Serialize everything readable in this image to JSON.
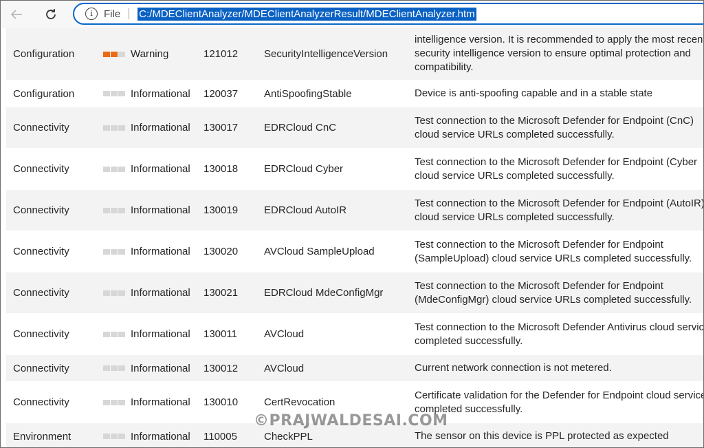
{
  "browser": {
    "scheme": "File",
    "url": "C:/MDEClientAnalyzer/MDEClientAnalyzerResult/MDEClientAnalyzer.htm"
  },
  "colors": {
    "warning": "#ea6a16",
    "info_bar": "#d7d7d7",
    "selection": "#0a61c4"
  },
  "rows": [
    {
      "category": "Configuration",
      "severity": "Warning",
      "id": "121012",
      "name": "SecurityIntelligenceVersion",
      "description": "intelligence version. It is recommended to apply the most recent security intelligence version to ensure optimal protection and compatibility."
    },
    {
      "category": "Configuration",
      "severity": "Informational",
      "id": "120037",
      "name": "AntiSpoofingStable",
      "description": "Device is anti-spoofing capable and in a stable state"
    },
    {
      "category": "Connectivity",
      "severity": "Informational",
      "id": "130017",
      "name": "EDRCloud CnC",
      "description": "Test connection to the Microsoft Defender for Endpoint (CnC) cloud service URLs completed successfully."
    },
    {
      "category": "Connectivity",
      "severity": "Informational",
      "id": "130018",
      "name": "EDRCloud Cyber",
      "description": "Test connection to the Microsoft Defender for Endpoint (Cyber cloud service URLs completed successfully."
    },
    {
      "category": "Connectivity",
      "severity": "Informational",
      "id": "130019",
      "name": "EDRCloud AutoIR",
      "description": "Test connection to the Microsoft Defender for Endpoint (AutoIR) cloud service URLs completed successfully."
    },
    {
      "category": "Connectivity",
      "severity": "Informational",
      "id": "130020",
      "name": "AVCloud SampleUpload",
      "description": "Test connection to the Microsoft Defender for Endpoint (SampleUpload) cloud service URLs completed successfully."
    },
    {
      "category": "Connectivity",
      "severity": "Informational",
      "id": "130021",
      "name": "EDRCloud MdeConfigMgr",
      "description": "Test connection to the Microsoft Defender for Endpoint (MdeConfigMgr) cloud service URLs completed successfully."
    },
    {
      "category": "Connectivity",
      "severity": "Informational",
      "id": "130011",
      "name": "AVCloud",
      "description": "Test connection to the Microsoft Defender Antivirus cloud service completed successfully."
    },
    {
      "category": "Connectivity",
      "severity": "Informational",
      "id": "130012",
      "name": "AVCloud",
      "description": "Current network connection is not metered."
    },
    {
      "category": "Connectivity",
      "severity": "Informational",
      "id": "130010",
      "name": "CertRevocation",
      "description": "Certificate validation for the Defender for Endpoint cloud service completed successfully."
    },
    {
      "category": "Environment",
      "severity": "Informational",
      "id": "110005",
      "name": "CheckPPL",
      "description": "The sensor on this device is PPL protected as expected"
    }
  ],
  "watermark": "©PRAJWALDESAI.COM"
}
